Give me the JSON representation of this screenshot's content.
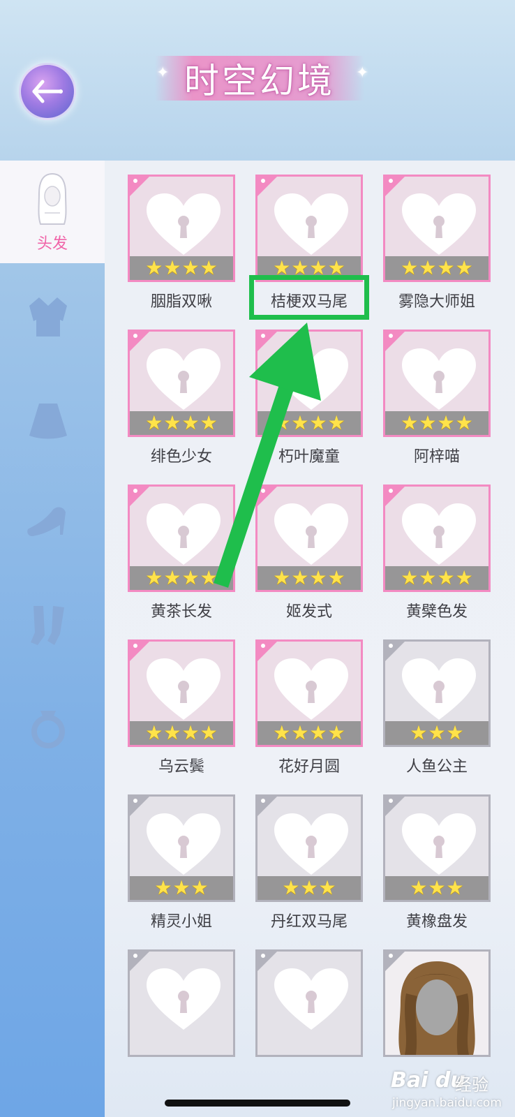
{
  "header": {
    "title": "时空幻境",
    "back_icon": "back-arrow-icon"
  },
  "sidebar": {
    "active_tab": {
      "label": "头发",
      "icon": "hair-icon"
    },
    "categories": [
      {
        "icon": "top-clothing-icon"
      },
      {
        "icon": "skirt-icon"
      },
      {
        "icon": "shoes-icon"
      },
      {
        "icon": "socks-icon"
      },
      {
        "icon": "ring-icon"
      }
    ]
  },
  "items": [
    {
      "name": "胭脂双啾",
      "stars": 4,
      "rarity": "pink"
    },
    {
      "name": "桔梗双马尾",
      "stars": 4,
      "rarity": "pink"
    },
    {
      "name": "雾隐大师姐",
      "stars": 4,
      "rarity": "pink"
    },
    {
      "name": "绯色少女",
      "stars": 4,
      "rarity": "pink"
    },
    {
      "name": "朽叶魔童",
      "stars": 4,
      "rarity": "pink"
    },
    {
      "name": "阿梓喵",
      "stars": 4,
      "rarity": "pink"
    },
    {
      "name": "黄茶长发",
      "stars": 4,
      "rarity": "pink"
    },
    {
      "name": "姬发式",
      "stars": 4,
      "rarity": "pink"
    },
    {
      "name": "黄檗色发",
      "stars": 4,
      "rarity": "pink"
    },
    {
      "name": "乌云鬓",
      "stars": 4,
      "rarity": "pink"
    },
    {
      "name": "花好月圆",
      "stars": 4,
      "rarity": "pink"
    },
    {
      "name": "人鱼公主",
      "stars": 3,
      "rarity": "grey"
    },
    {
      "name": "精灵小姐",
      "stars": 3,
      "rarity": "grey"
    },
    {
      "name": "丹红双马尾",
      "stars": 3,
      "rarity": "grey"
    },
    {
      "name": "黄橡盘发",
      "stars": 3,
      "rarity": "grey"
    },
    {
      "name": "",
      "stars": 0,
      "rarity": "grey"
    },
    {
      "name": "",
      "stars": 0,
      "rarity": "grey"
    },
    {
      "name": "",
      "stars": 0,
      "rarity": "grey",
      "preview": "hair-preview"
    }
  ],
  "annotation": {
    "highlight_color": "#1fbe4c",
    "highlighted_item": "桔梗双马尾"
  },
  "watermark": {
    "logo": "Bai du",
    "text": "经验",
    "url": "jingyan.baidu.com"
  }
}
